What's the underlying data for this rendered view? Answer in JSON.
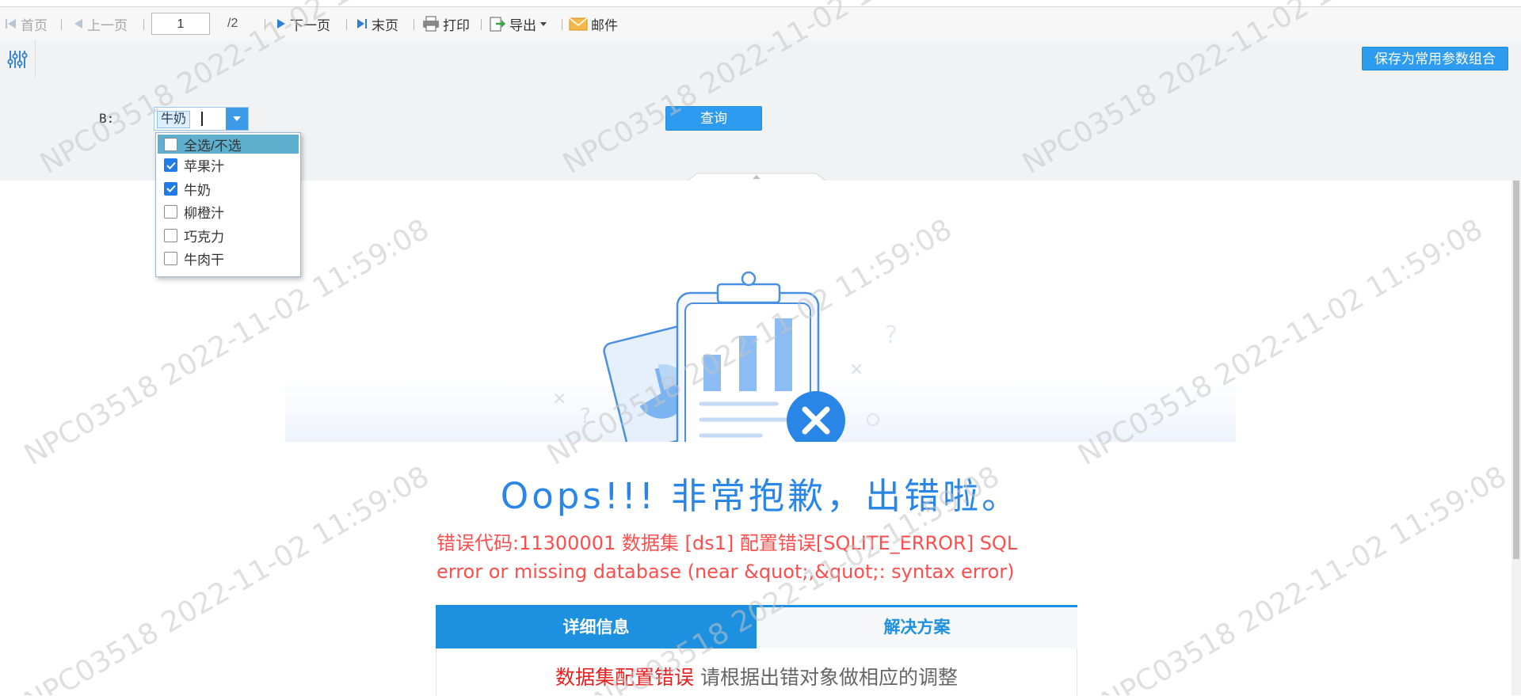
{
  "toolbar": {
    "first": "首页",
    "prev": "上一页",
    "page_value": "1",
    "total": "/2",
    "next": "下一页",
    "last": "末页",
    "print": "打印",
    "export": "导出",
    "mail": "邮件"
  },
  "params_bar": {
    "save_button": "保存为常用参数组合"
  },
  "params": {
    "b_label": "B:",
    "selected_tag": "牛奶",
    "query_button": "查询",
    "options": [
      {
        "label": "全选/不选",
        "checked": false
      },
      {
        "label": "苹果汁",
        "checked": true
      },
      {
        "label": "牛奶",
        "checked": true
      },
      {
        "label": "柳橙汁",
        "checked": false
      },
      {
        "label": "巧克力",
        "checked": false
      },
      {
        "label": "牛肉干",
        "checked": false
      }
    ]
  },
  "error": {
    "title": "Oops!!! 非常抱歉，出错啦。",
    "message": "错误代码:11300001 数据集 [ds1] 配置错误[SQLITE_ERROR] SQL error or missing database (near &quot;,&quot;: syntax error)",
    "tab_detail": "详细信息",
    "tab_solution": "解决方案",
    "detail_strong": "数据集配置错误",
    "detail_text": "请根据出错对象做相应的调整"
  },
  "watermark": {
    "user": "NPC03518",
    "date": "2022-11-02",
    "time": "11:59:08"
  },
  "colors": {
    "accent": "#2d9cf0",
    "error_red": "#ff4d4d",
    "title_blue": "#2a86e6"
  }
}
